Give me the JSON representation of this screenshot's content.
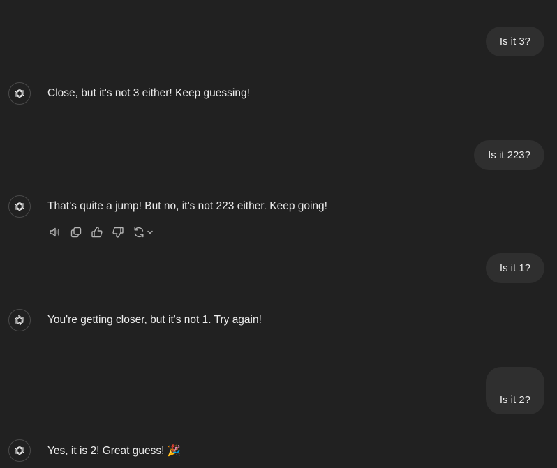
{
  "conversation": {
    "messages": [
      {
        "role": "user",
        "text": "Is it 3?"
      },
      {
        "role": "assistant",
        "text": "Close, but it's not 3 either! Keep guessing!"
      },
      {
        "role": "user",
        "text": "Is it 223?"
      },
      {
        "role": "assistant",
        "text": "That’s quite a jump! But no, it’s not 223 either. Keep going!"
      },
      {
        "role": "user",
        "text": "Is it 1?"
      },
      {
        "role": "assistant",
        "text": "You're getting closer, but it's not 1. Try again!"
      },
      {
        "role": "user",
        "text": "Is it 2?"
      },
      {
        "role": "assistant",
        "text": "Yes, it is 2! Great guess! 🎉"
      }
    ]
  },
  "message_actions": {
    "icons": [
      "read-aloud-icon",
      "copy-icon",
      "thumbs-up-icon",
      "thumbs-down-icon",
      "regenerate-icon",
      "chevron-down-icon"
    ]
  },
  "colors": {
    "background": "#212121",
    "user_bubble": "#2f2f2f",
    "text": "#ececec",
    "icon": "#b4b4b4"
  }
}
